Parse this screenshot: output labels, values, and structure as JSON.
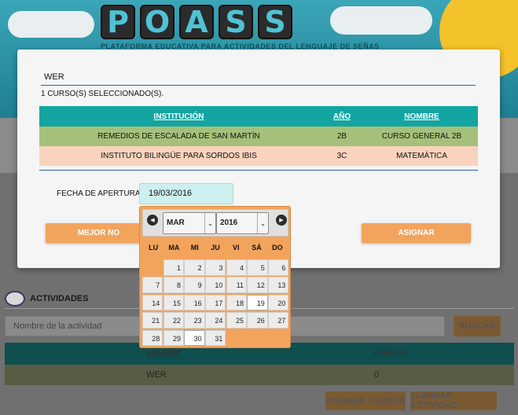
{
  "background": {
    "logo_letters": [
      "P",
      "O",
      "A",
      "S",
      "S"
    ],
    "subtitle": "PLATAFORMA EDUCATIVA PARA ACTIVIDADES DEL LENGUAJE DE SEÑAS",
    "activities": {
      "title": "ACTIVIDADES",
      "search_placeholder": "Nombre de la actividad",
      "search_button": "BUSCAR",
      "columns": [
        "NOMBRE",
        "CURSOS"
      ],
      "rows": [
        {
          "name": "WER",
          "courses": "0"
        }
      ],
      "assign_courses_button": "ASIGNAR CURSOS",
      "delete_button": "ELIMINAR ACTIVIDAD"
    }
  },
  "modal": {
    "activity_name": "WER",
    "selected_count": "1 CURSO(S) SELECCIONADO(S).",
    "table": {
      "headers": {
        "institucion": "INSTITUCIÓN",
        "anio": "AÑO",
        "nombre": "NOMBRE"
      },
      "rows": [
        {
          "institucion": "REMEDIOS DE ESCALADA DE SAN MARTÍN",
          "anio": "2B",
          "nombre": "CURSO GENERAL 2B"
        },
        {
          "institucion": "INSTITUTO BILINGÜE PARA SORDOS IBIS",
          "anio": "3C",
          "nombre": "MATEMÁTICA"
        }
      ]
    },
    "date_label": "FECHA DE APERTURA:",
    "date_value": "19/03/2016",
    "cancel_button": "MEJOR NO",
    "assign_button": "ASIGNAR"
  },
  "datepicker": {
    "month": "MAR",
    "year": "2016",
    "weekdays": [
      "LU",
      "MA",
      "MI",
      "JU",
      "VI",
      "SÁ",
      "DO"
    ],
    "weeks": [
      [
        "",
        "1",
        "2",
        "3",
        "4",
        "5",
        "6"
      ],
      [
        "7",
        "8",
        "9",
        "10",
        "11",
        "12",
        "13"
      ],
      [
        "14",
        "15",
        "16",
        "17",
        "18",
        "19",
        "20"
      ],
      [
        "21",
        "22",
        "23",
        "24",
        "25",
        "26",
        "27"
      ],
      [
        "28",
        "29",
        "30",
        "31",
        "",
        "",
        ""
      ]
    ],
    "selected_day": "19",
    "today_day": "30",
    "colors": {
      "accent": "#f2a45d",
      "teal": "#12a5a2"
    }
  }
}
